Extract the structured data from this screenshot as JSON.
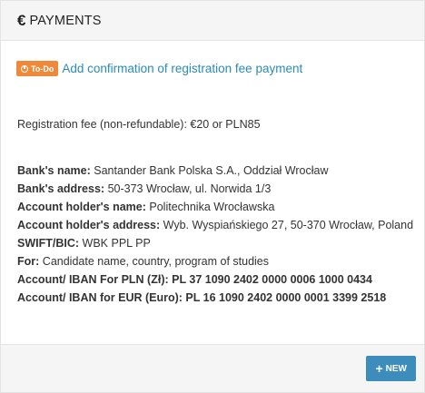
{
  "header": {
    "icon": "euro-icon",
    "icon_glyph": "€",
    "title": "PAYMENTS"
  },
  "todo": {
    "badge_icon": "clock-icon",
    "badge_label": "To-Do",
    "badge_color": "#f0883a",
    "link_text": "Add confirmation of registration fee payment",
    "link_color": "#2a8bb8"
  },
  "fee_text": "Registration fee (non-refundable): €20 or PLN85",
  "details": [
    {
      "label": "Bank's name:",
      "value": "Santander Bank Polska S.A., Oddział Wrocław"
    },
    {
      "label": "Bank's address:",
      "value": "50-373 Wrocław, ul. Norwida 1/3"
    },
    {
      "label": "Account holder's name:",
      "value": "Politechnika Wrocławska"
    },
    {
      "label": "Account holder's address:",
      "value": "Wyb. Wyspiańskiego 27, 50-370 Wrocław, Poland"
    },
    {
      "label": "SWIFT/BIC:",
      "value": "WBK PPL PP"
    },
    {
      "label": "For:",
      "value": "Candidate name, country, program of studies"
    },
    {
      "label": "Account/ IBAN For PLN (Zł):",
      "value": "PL 37 1090 2402 0000 0006 1000 0434"
    },
    {
      "label": "Account/ IBAN for EUR (Euro):",
      "value": "PL 16 1090 2402 0000 0001 3399 2518"
    }
  ],
  "footer": {
    "new_button_icon": "plus-icon",
    "new_button_label": "NEW",
    "accent": "#3c8dbc"
  }
}
